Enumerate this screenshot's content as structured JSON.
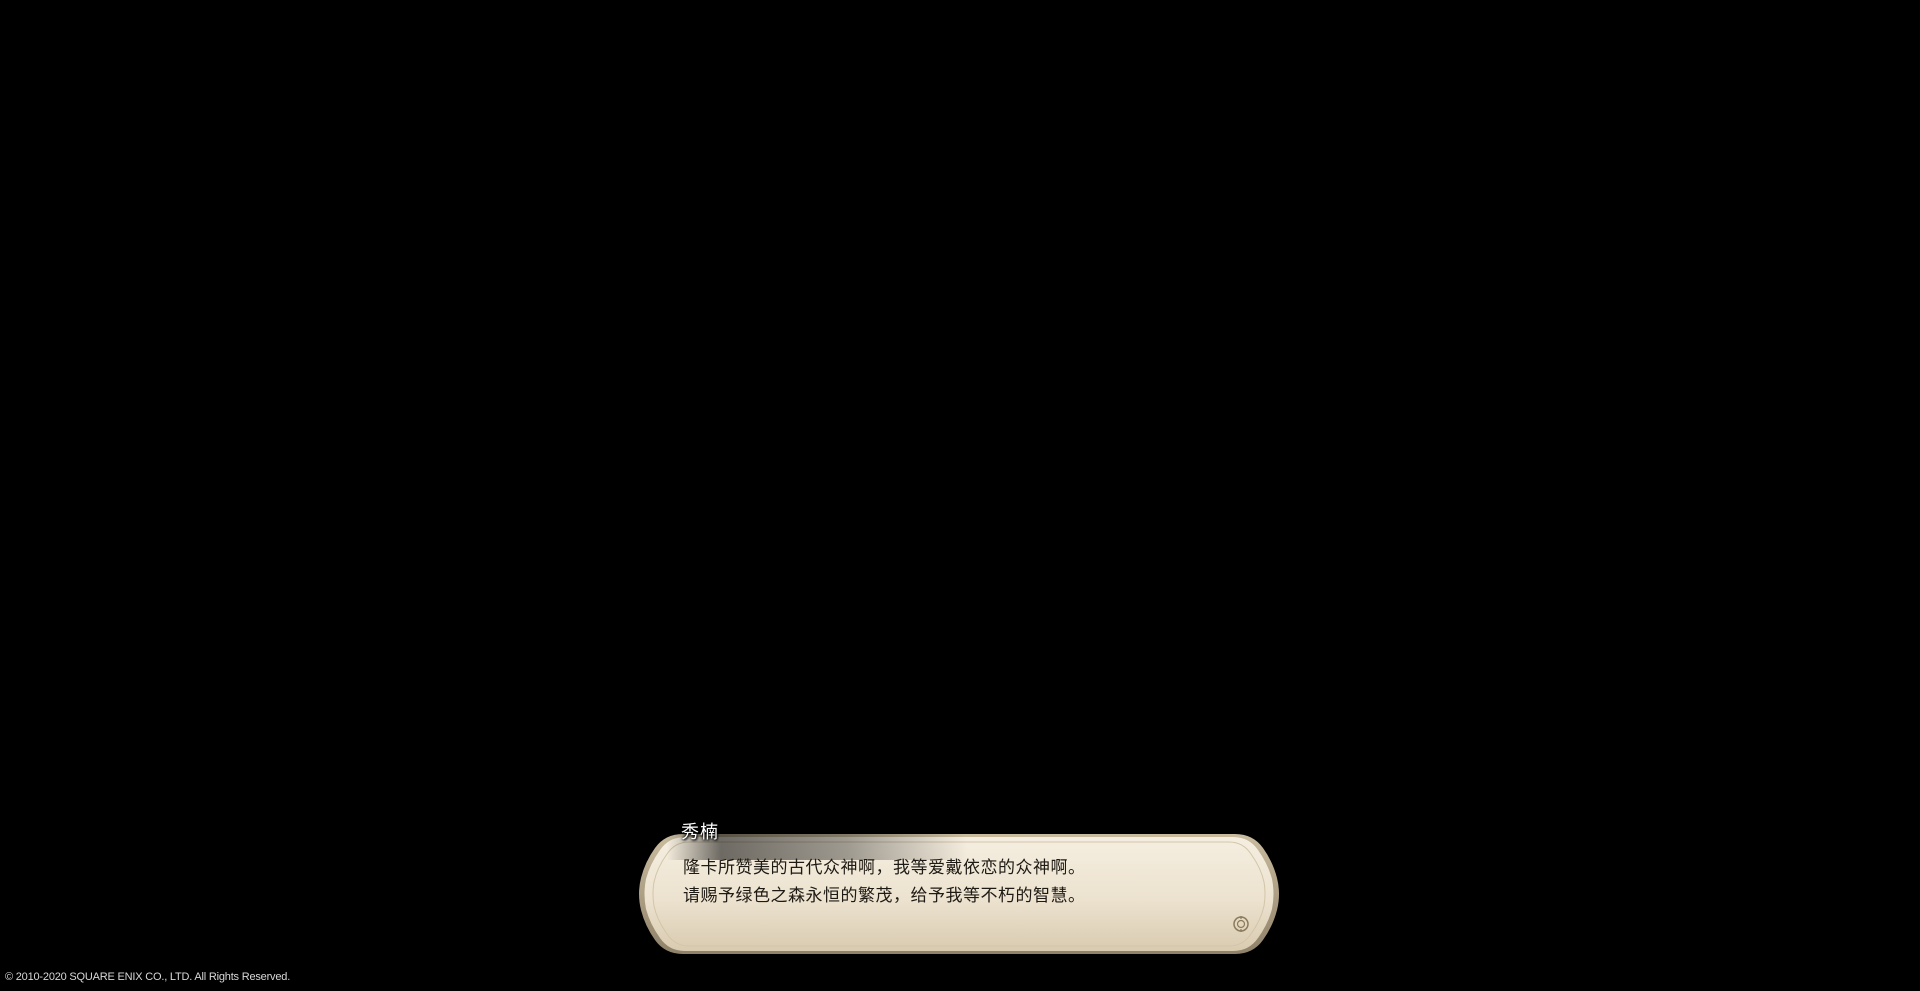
{
  "dialog": {
    "speaker": "秀楠",
    "lines": [
      "隆卡所赞美的古代众神啊，我等爱戴依恋的众神啊。",
      "请赐予绿色之森永恒的繁茂，给予我等不朽的智慧。"
    ],
    "advance_icon": "advance-cursor-icon"
  },
  "footer": {
    "copyright": "© 2010-2020 SQUARE ENIX CO., LTD. All Rights Reserved."
  },
  "colors": {
    "background": "#000000",
    "panel_light": "#f1e9da",
    "panel_dark": "#cdbfa4",
    "border": "#a89a80",
    "text": "#1e1a14",
    "speaker_text": "#ffffff"
  }
}
